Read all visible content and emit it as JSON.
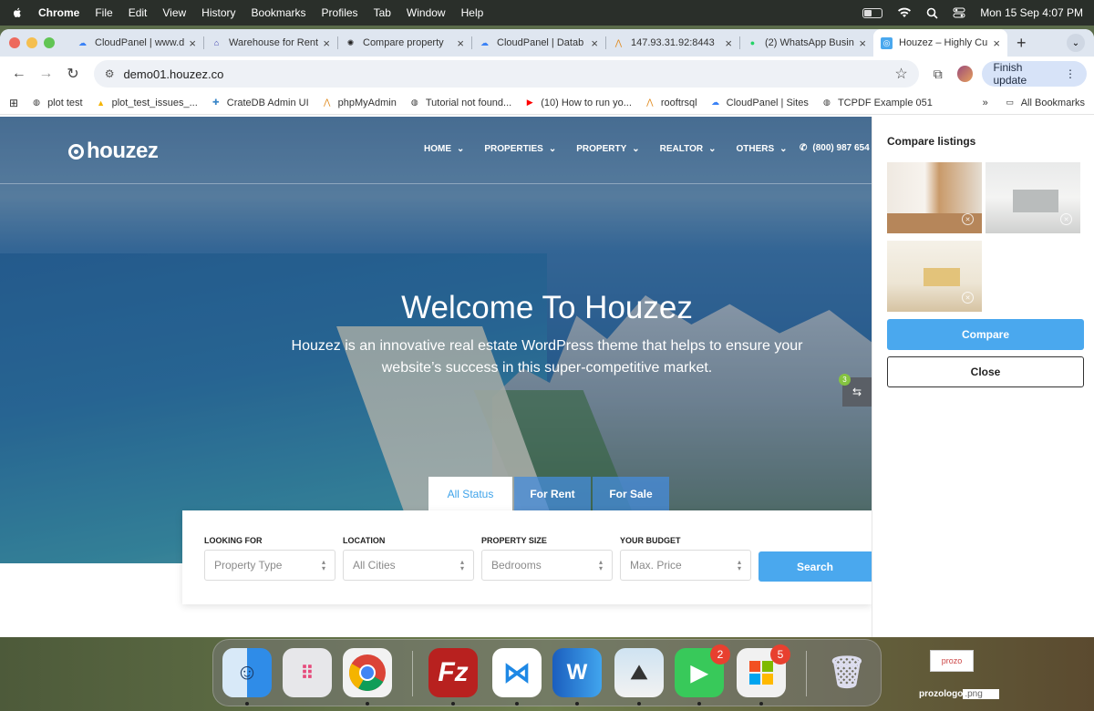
{
  "menubar": {
    "app": "Chrome",
    "items": [
      "File",
      "Edit",
      "View",
      "History",
      "Bookmarks",
      "Profiles",
      "Tab",
      "Window",
      "Help"
    ],
    "datetime": "Mon 15 Sep  4:07 PM"
  },
  "tabs": [
    {
      "title": "CloudPanel | www.d",
      "icon": "cloud-icon"
    },
    {
      "title": "Warehouse for Rent",
      "icon": "house-icon"
    },
    {
      "title": "Compare property",
      "icon": "openai-icon"
    },
    {
      "title": "CloudPanel | Datab",
      "icon": "cloud-icon"
    },
    {
      "title": "147.93.31.92:8443",
      "icon": "pma-icon"
    },
    {
      "title": "(2) WhatsApp Busin",
      "icon": "whatsapp-icon"
    },
    {
      "title": "Houzez – Highly Cu",
      "icon": "houzez-icon",
      "active": true
    }
  ],
  "toolbar": {
    "url": "demo01.houzez.co",
    "finish_update": "Finish update"
  },
  "bookmarks": [
    {
      "label": "plot test",
      "icon": "globe-icon"
    },
    {
      "label": "plot_test_issues_...",
      "icon": "drive-icon"
    },
    {
      "label": "CrateDB Admin UI",
      "icon": "crate-icon"
    },
    {
      "label": "phpMyAdmin",
      "icon": "pma-icon"
    },
    {
      "label": "Tutorial not found...",
      "icon": "globe-icon"
    },
    {
      "label": "(10) How to run yo...",
      "icon": "youtube-icon"
    },
    {
      "label": "rooftrsql",
      "icon": "pma-icon"
    },
    {
      "label": "CloudPanel | Sites",
      "icon": "cloud-icon"
    },
    {
      "label": "TCPDF Example 051",
      "icon": "globe-icon"
    }
  ],
  "all_bookmarks": "All Bookmarks",
  "site": {
    "logo": "houzez",
    "nav": [
      "HOME",
      "PROPERTIES",
      "PROPERTY",
      "REALTOR",
      "OTHERS"
    ],
    "phone": "(800) 987 654",
    "hero_title": "Welcome To Houzez",
    "hero_subtitle": "Houzez is an innovative real estate WordPress theme that helps to ensure your website’s success in this super-competitive market.",
    "compare_count": "3",
    "status_tabs": [
      "All Status",
      "For Rent",
      "For Sale"
    ],
    "search": {
      "fields": [
        {
          "label": "LOOKING FOR",
          "value": "Property Type"
        },
        {
          "label": "LOCATION",
          "value": "All Cities"
        },
        {
          "label": "PROPERTY SIZE",
          "value": "Bedrooms"
        },
        {
          "label": "YOUR BUDGET",
          "value": "Max. Price"
        }
      ],
      "button": "Search"
    }
  },
  "compare_panel": {
    "title": "Compare listings",
    "compare_button": "Compare",
    "close_button": "Close"
  },
  "dock": {
    "facetime_badge": "2",
    "installer_badge": "5",
    "desktop_file_label": "prozologo",
    "desktop_file_ext": ".png",
    "desktop_file_thumb": "prozo"
  },
  "colors": {
    "accent": "#4aa8ee",
    "badge": "#85c341"
  }
}
